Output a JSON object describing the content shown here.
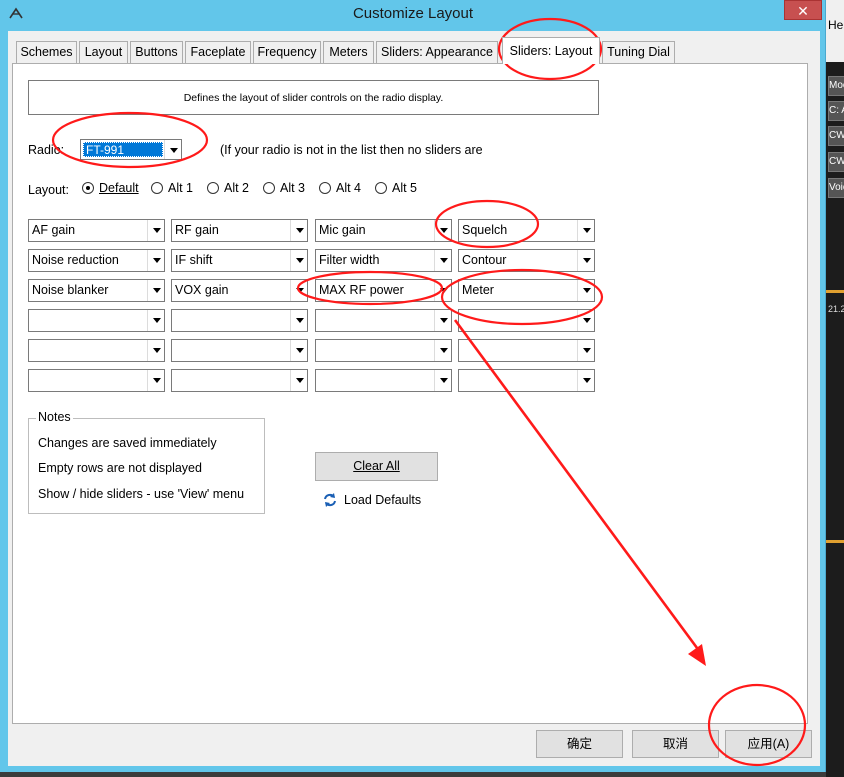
{
  "window": {
    "title": "Customize Layout",
    "close_glyph": "✕"
  },
  "background_app": {
    "top_text": "He",
    "items": [
      "Moc",
      "C: A",
      "CW",
      "CW",
      "Voic"
    ],
    "readout": "21.2"
  },
  "tabs": [
    {
      "label": "Schemes",
      "active": false
    },
    {
      "label": "Layout",
      "active": false
    },
    {
      "label": "Buttons",
      "active": false
    },
    {
      "label": "Faceplate",
      "active": false
    },
    {
      "label": "Frequency",
      "active": false
    },
    {
      "label": "Meters",
      "active": false
    },
    {
      "label": "Sliders: Appearance",
      "active": false
    },
    {
      "label": "Sliders: Layout",
      "active": true
    },
    {
      "label": "Tuning Dial",
      "active": false
    }
  ],
  "description": "Defines the layout of slider controls on the radio display.",
  "radio": {
    "label": "Radio:",
    "selected": "FT-991",
    "note": "(If your radio is not in the list then no sliders are"
  },
  "layout": {
    "label": "Layout:",
    "options": [
      {
        "label": "Default",
        "checked": true
      },
      {
        "label": "Alt 1",
        "checked": false
      },
      {
        "label": "Alt 2",
        "checked": false
      },
      {
        "label": "Alt 3",
        "checked": false
      },
      {
        "label": "Alt 4",
        "checked": false
      },
      {
        "label": "Alt 5",
        "checked": false
      }
    ]
  },
  "slider_grid": [
    [
      "AF gain",
      "RF gain",
      "Mic gain",
      "Squelch"
    ],
    [
      "Noise reduction",
      "IF shift",
      "Filter width",
      "Contour"
    ],
    [
      "Noise blanker",
      "VOX gain",
      "MAX RF power",
      "Meter"
    ],
    [
      "",
      "",
      "",
      ""
    ],
    [
      "",
      "",
      "",
      ""
    ],
    [
      "",
      "",
      "",
      ""
    ]
  ],
  "notes": {
    "title": "Notes",
    "lines": [
      "Changes are saved immediately",
      "Empty rows are not displayed",
      "Show / hide sliders - use 'View' menu"
    ]
  },
  "buttons": {
    "clear_all": "Clear All",
    "load_defaults": "Load Defaults",
    "ok": "确定",
    "cancel": "取消",
    "apply": "应用(A)"
  },
  "colors": {
    "title_bar": "#62c6ea",
    "selection": "#0078d7",
    "annotation_red": "#ff1a1a"
  },
  "icons": [
    "app-icon",
    "close-icon",
    "chevron-down-icon",
    "refresh-icon"
  ]
}
